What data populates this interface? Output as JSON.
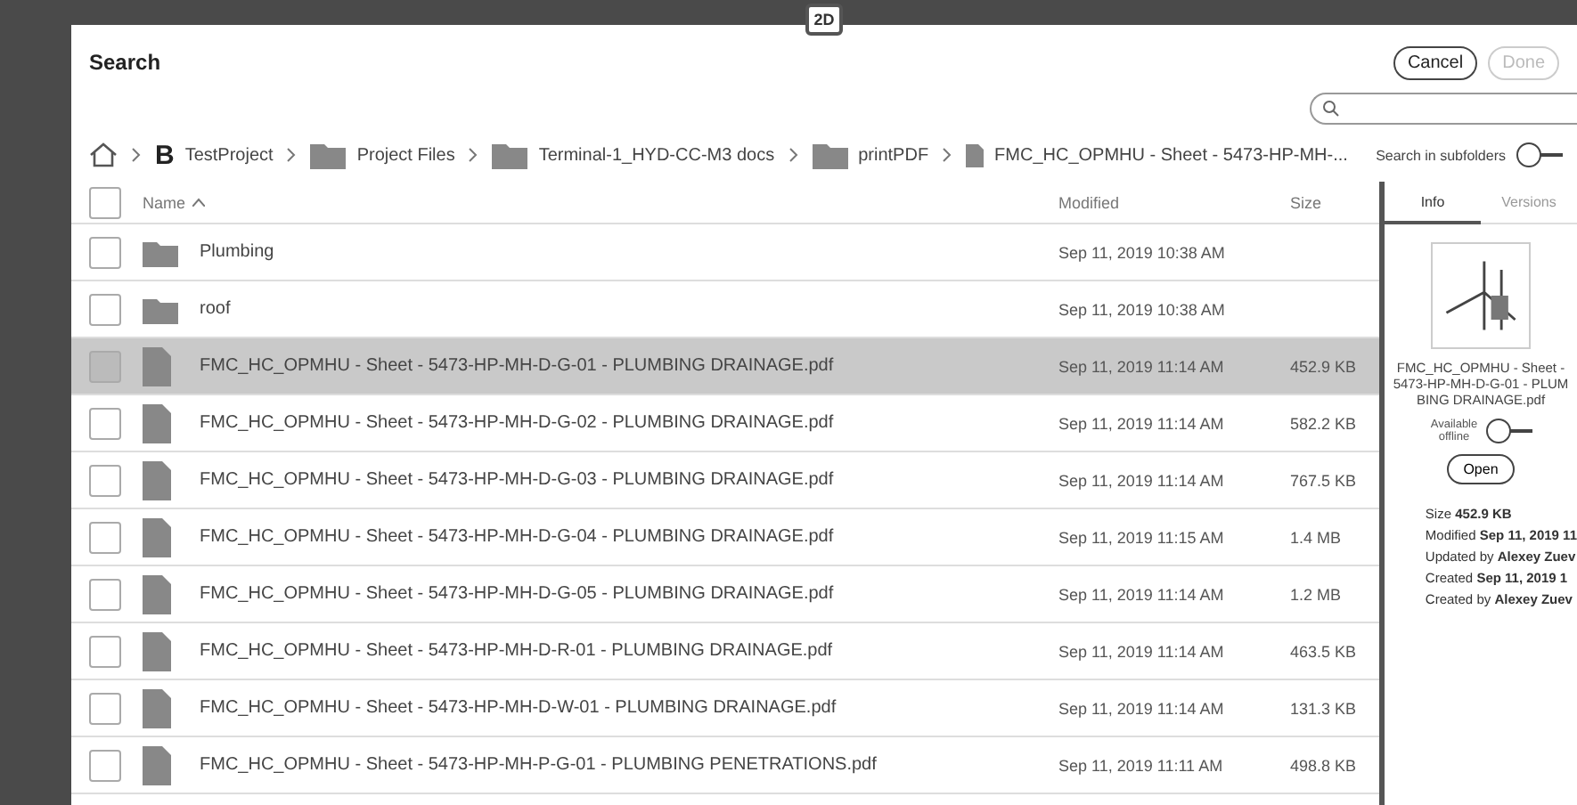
{
  "top_bar": {
    "badge": "2D"
  },
  "dialog": {
    "title": "Search",
    "buttons": [
      {
        "label": "Cancel",
        "disabled": false
      },
      {
        "label": "Done",
        "disabled": true
      }
    ]
  },
  "search": {
    "subfolders_label": "Search in subfolders",
    "subfolders_on": false
  },
  "breadcrumb": [
    {
      "kind": "project",
      "badge": "B",
      "label": "TestProject"
    },
    {
      "kind": "folder",
      "label": "Project Files"
    },
    {
      "kind": "folder",
      "label": "Terminal-1_HYD-CC-M3 docs"
    },
    {
      "kind": "folder",
      "label": "printPDF"
    },
    {
      "kind": "file",
      "label": "FMC_HC_OPMHU - Sheet - 5473-HP-MH-..."
    }
  ],
  "select_all": {
    "checked": false
  },
  "columns": [
    {
      "label": "Name",
      "sorted": true
    },
    {
      "label": "Modified",
      "sorted": false
    },
    {
      "label": "Size",
      "sorted": false
    }
  ],
  "rows": [
    {
      "kind": "folder",
      "name": "Plumbing",
      "modified": "Sep 11, 2019 10:38 AM",
      "selected": false
    },
    {
      "kind": "folder",
      "name": "roof",
      "modified": "Sep 11, 2019 10:38 AM",
      "selected": false
    },
    {
      "kind": "pdf",
      "name": "FMC_HC_OPMHU - Sheet - 5473-HP-MH-D-G-01 - PLUMBING DRAINAGE.pdf",
      "modified": "Sep 11, 2019 11:14 AM",
      "size": "452.9 KB",
      "selected": true
    },
    {
      "kind": "pdf",
      "name": "FMC_HC_OPMHU - Sheet - 5473-HP-MH-D-G-02 - PLUMBING DRAINAGE.pdf",
      "modified": "Sep 11, 2019 11:14 AM",
      "size": "582.2 KB",
      "selected": false
    },
    {
      "kind": "pdf",
      "name": "FMC_HC_OPMHU - Sheet - 5473-HP-MH-D-G-03 - PLUMBING DRAINAGE.pdf",
      "modified": "Sep 11, 2019 11:14 AM",
      "size": "767.5 KB",
      "selected": false
    },
    {
      "kind": "pdf",
      "name": "FMC_HC_OPMHU - Sheet - 5473-HP-MH-D-G-04 - PLUMBING DRAINAGE.pdf",
      "modified": "Sep 11, 2019 11:15 AM",
      "size": "1.4 MB",
      "selected": false
    },
    {
      "kind": "pdf",
      "name": "FMC_HC_OPMHU - Sheet - 5473-HP-MH-D-G-05 - PLUMBING DRAINAGE.pdf",
      "modified": "Sep 11, 2019 11:14 AM",
      "size": "1.2 MB",
      "selected": false
    },
    {
      "kind": "pdf",
      "name": "FMC_HC_OPMHU - Sheet - 5473-HP-MH-D-R-01 - PLUMBING DRAINAGE.pdf",
      "modified": "Sep 11, 2019 11:14 AM",
      "size": "463.5 KB",
      "selected": false
    },
    {
      "kind": "pdf",
      "name": "FMC_HC_OPMHU - Sheet - 5473-HP-MH-D-W-01 - PLUMBING DRAINAGE.pdf",
      "modified": "Sep 11, 2019 11:14 AM",
      "size": "131.3 KB",
      "selected": false
    },
    {
      "kind": "pdf",
      "name": "FMC_HC_OPMHU - Sheet - 5473-HP-MH-P-G-01 - PLUMBING PENETRATIONS.pdf",
      "modified": "Sep 11, 2019 11:11 AM",
      "size": "498.8 KB",
      "selected": false
    }
  ],
  "panel": {
    "tabs": [
      {
        "label": "Info",
        "selected": true
      },
      {
        "label": "Versions",
        "selected": false
      }
    ],
    "file_name": "FMC_HC_OPMHU - Sheet - 5473-HP-MH-D-G-01 - PLUMBING DRAINAGE.pdf",
    "offline_label": "Available offline",
    "offline_on": false,
    "open_label": "Open",
    "details": [
      {
        "label": "Size",
        "value": "452.9 KB"
      },
      {
        "label": "Modified",
        "value": "Sep 11, 2019 11"
      },
      {
        "label": "Updated by",
        "value": "Alexey Zuev"
      },
      {
        "label": "Created",
        "value": "Sep 11, 2019 1"
      },
      {
        "label": "Created by",
        "value": "Alexey Zuev"
      }
    ]
  }
}
